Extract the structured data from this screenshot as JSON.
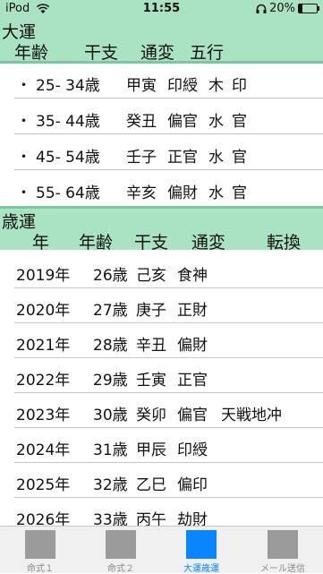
{
  "status": {
    "carrier": "iPod",
    "time": "11:55",
    "battery": "20%",
    "battery_level": 0.2
  },
  "taiun": {
    "title": "大運",
    "headers": [
      "年齢",
      "干支",
      "通変",
      "五行"
    ],
    "rows": [
      {
        "bullet": "・",
        "age": "25- 34歳",
        "kanshi": "甲寅",
        "tsuhen": "印綬",
        "gogyo": "木",
        "type": "印"
      },
      {
        "bullet": "・",
        "age": "35- 44歳",
        "kanshi": "癸丑",
        "tsuhen": "偏官",
        "gogyo": "水",
        "type": "官"
      },
      {
        "bullet": "・",
        "age": "45- 54歳",
        "kanshi": "壬子",
        "tsuhen": "正官",
        "gogyo": "水",
        "type": "官"
      },
      {
        "bullet": "・",
        "age": "55- 64歳",
        "kanshi": "辛亥",
        "tsuhen": "偏財",
        "gogyo": "水",
        "type": "官"
      }
    ]
  },
  "saiun": {
    "title": "歳運",
    "headers": [
      "年",
      "年齢",
      "干支",
      "通変",
      "転換"
    ],
    "rows": [
      {
        "year": "2019年",
        "age": "26歳",
        "kanshi": "己亥",
        "tsuhen": "食神",
        "tenkan": ""
      },
      {
        "year": "2020年",
        "age": "27歳",
        "kanshi": "庚子",
        "tsuhen": "正財",
        "tenkan": ""
      },
      {
        "year": "2021年",
        "age": "28歳",
        "kanshi": "辛丑",
        "tsuhen": "偏財",
        "tenkan": ""
      },
      {
        "year": "2022年",
        "age": "29歳",
        "kanshi": "壬寅",
        "tsuhen": "正官",
        "tenkan": ""
      },
      {
        "year": "2023年",
        "age": "30歳",
        "kanshi": "癸卯",
        "tsuhen": "偏官",
        "tenkan": "天戦地冲"
      },
      {
        "year": "2024年",
        "age": "31歳",
        "kanshi": "甲辰",
        "tsuhen": "印綬",
        "tenkan": ""
      },
      {
        "year": "2025年",
        "age": "32歳",
        "kanshi": "乙巳",
        "tsuhen": "偏印",
        "tenkan": ""
      },
      {
        "year": "2026年",
        "age": "33歳",
        "kanshi": "丙午",
        "tsuhen": "劫財",
        "tenkan": ""
      }
    ]
  },
  "tabs": [
    {
      "label": "命式１",
      "icon": "meishiki-1-icon",
      "active": false
    },
    {
      "label": "命式２",
      "icon": "meishiki-2-icon",
      "active": false
    },
    {
      "label": "大運歳運",
      "icon": "taiun-saiun-icon",
      "active": true
    },
    {
      "label": "メール送信",
      "icon": "mail-send-icon",
      "active": false
    }
  ],
  "colors": {
    "header_bg": "#a9e3c4",
    "active_tab": "#0a84ff",
    "inactive_tab": "#9b9b9b"
  }
}
